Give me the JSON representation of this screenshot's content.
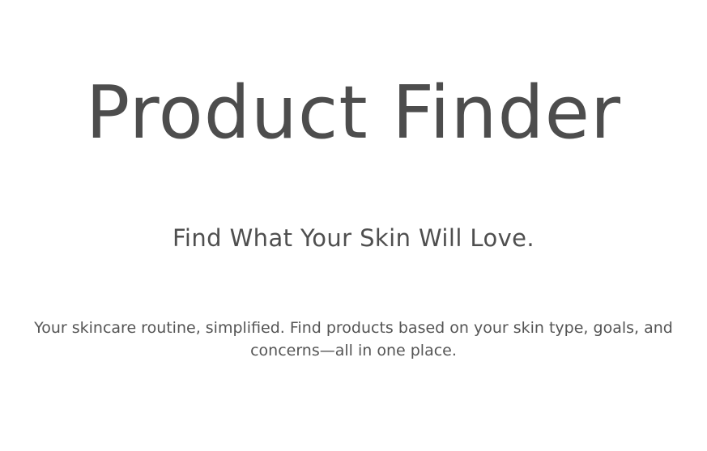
{
  "hero": {
    "title": "Product Finder",
    "subtitle": "Find What Your Skin Will Love.",
    "description": "Your skincare routine, simplified. Find products based on your skin type, goals, and concerns—all in one place."
  }
}
